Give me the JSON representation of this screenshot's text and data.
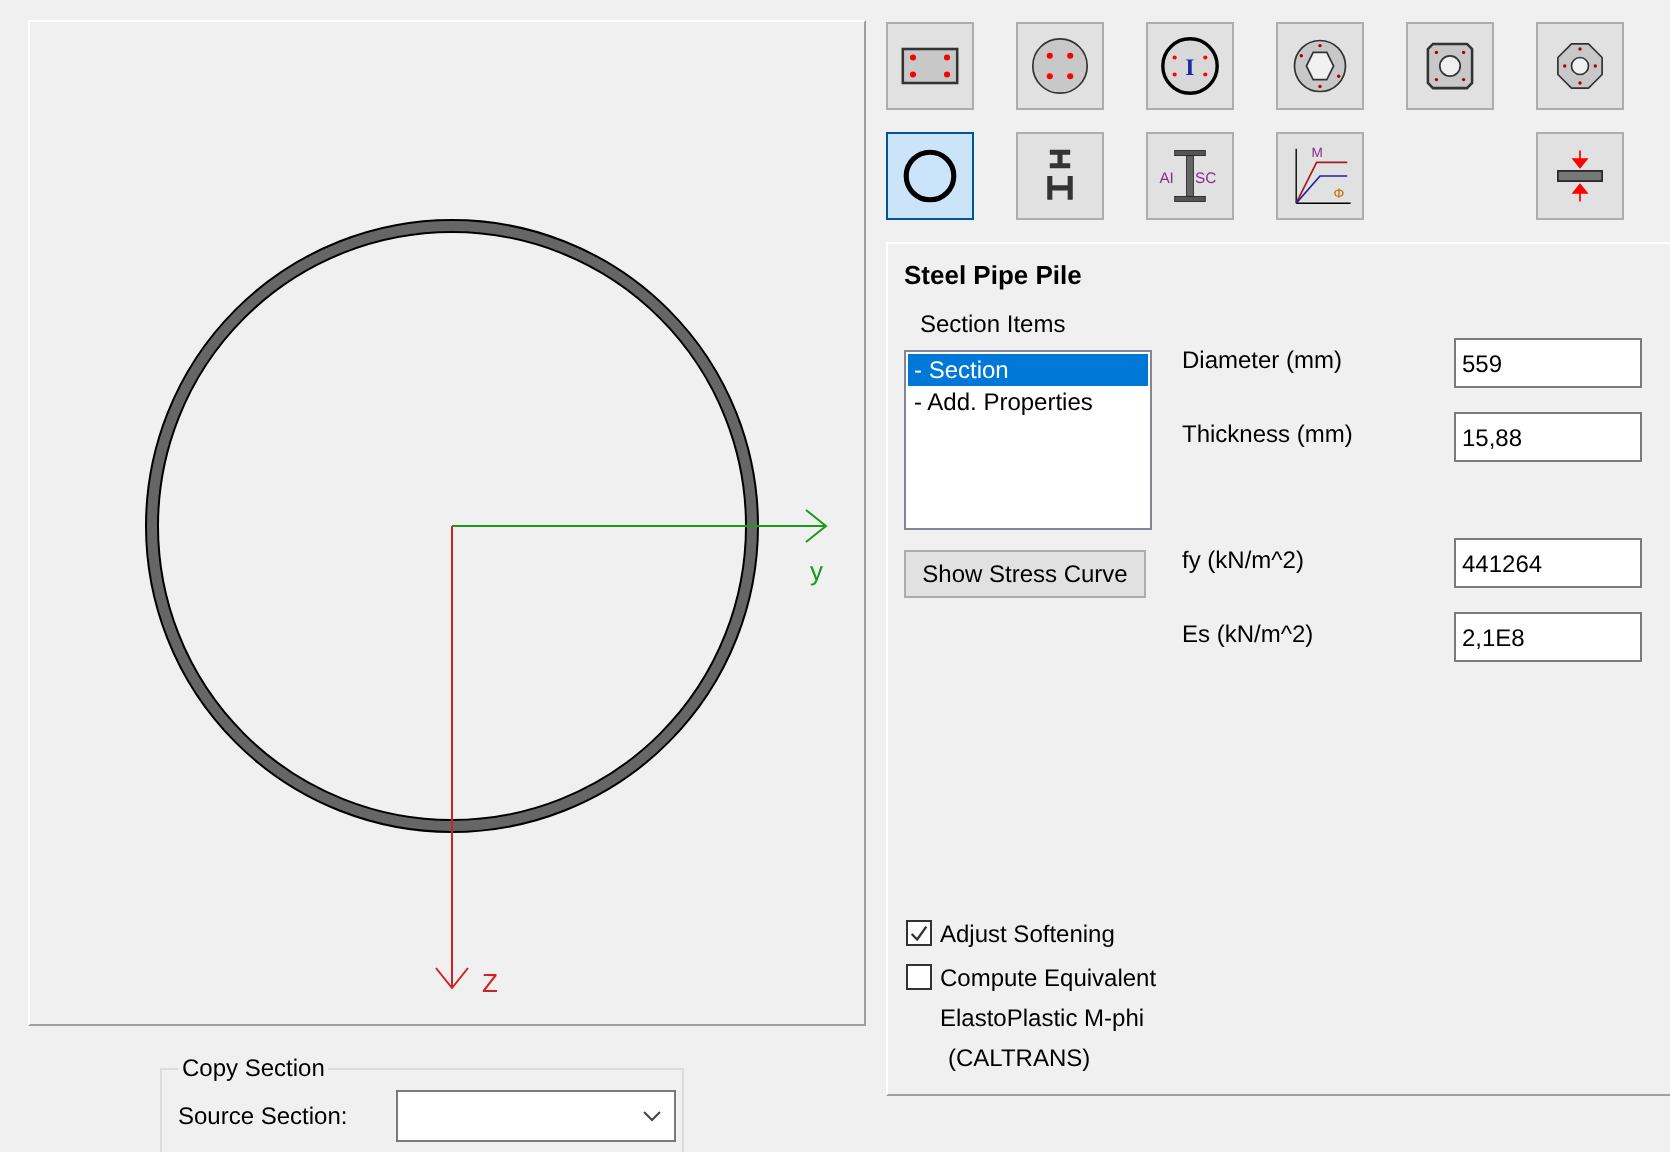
{
  "toolbar_rows": [
    [
      {
        "kind": "rect-bars",
        "selected": false
      },
      {
        "kind": "circle-bars",
        "selected": false
      },
      {
        "kind": "circle-steel",
        "label": "I",
        "selected": false
      },
      {
        "kind": "ring-bars",
        "selected": false
      },
      {
        "kind": "square-hollow",
        "selected": false
      },
      {
        "kind": "octagon-hollow",
        "selected": false
      }
    ],
    [
      {
        "kind": "pipe",
        "selected": true
      },
      {
        "kind": "h-beam",
        "selected": false
      },
      {
        "kind": "aisc",
        "labels": [
          "AI",
          "SC"
        ],
        "selected": false
      },
      {
        "kind": "mphi",
        "labels": [
          "M",
          "Φ"
        ],
        "selected": false
      },
      {
        "kind": "axial",
        "selected": false
      }
    ]
  ],
  "drawing": {
    "y_axis_label": "y",
    "z_axis_label": "Z"
  },
  "panel": {
    "title": "Steel Pipe Pile",
    "items_label": "Section Items",
    "items": [
      {
        "label": "- Section",
        "selected": true
      },
      {
        "label": "- Add. Properties",
        "selected": false
      }
    ],
    "stress_button": "Show Stress Curve",
    "field_groups": [
      [
        {
          "label": "Diameter (mm)",
          "value": "559"
        },
        {
          "label": "Thickness (mm)",
          "value": "15,88"
        }
      ],
      [
        {
          "label": "fy (kN/m^2)",
          "value": "441264"
        },
        {
          "label": "Es (kN/m^2)",
          "value": "2,1E8"
        }
      ]
    ],
    "options": [
      {
        "lines": [
          "Adjust Softening"
        ],
        "checked": true
      },
      {
        "lines": [
          "Compute Equivalent",
          "ElastoPlastic M-phi",
          "(CALTRANS)"
        ],
        "checked": false
      }
    ]
  },
  "copy_section": {
    "title": "Copy Section",
    "source_label": "Source Section:"
  }
}
